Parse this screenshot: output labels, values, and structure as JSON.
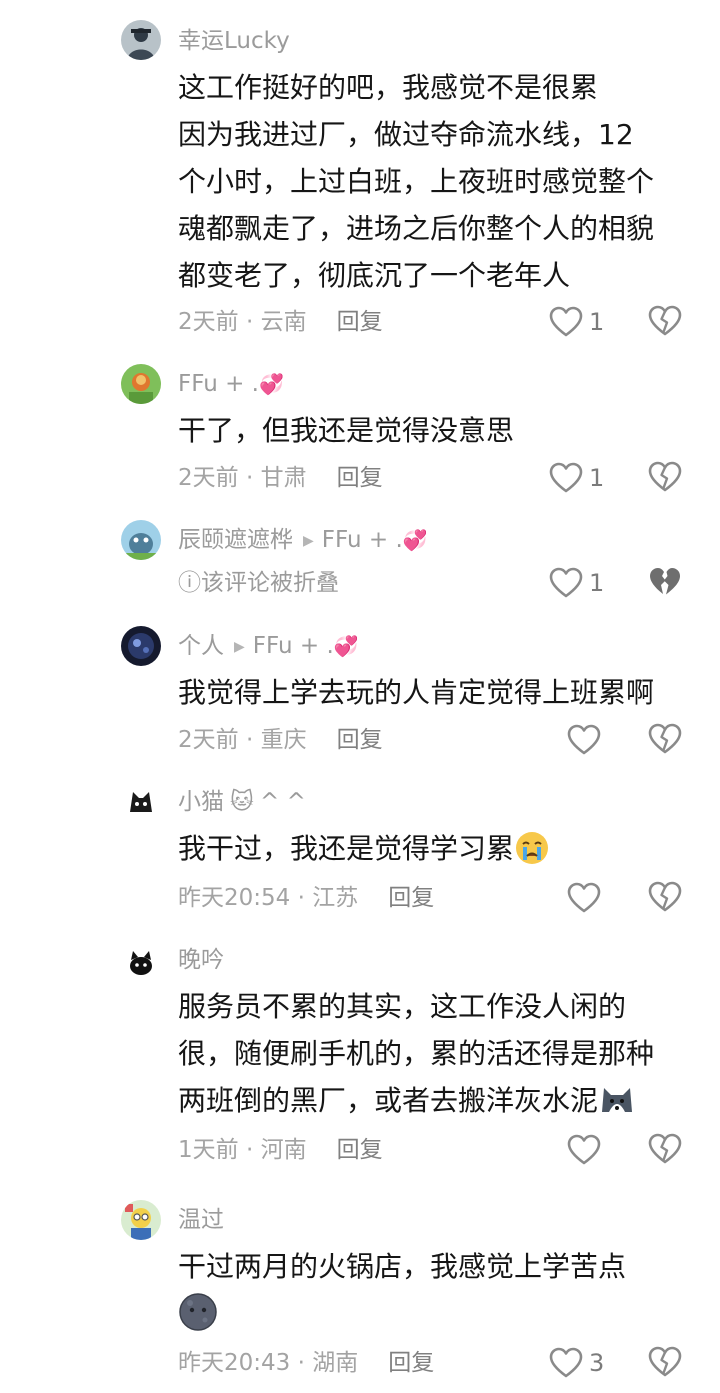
{
  "comments": [
    {
      "username": "幸运Lucky",
      "text_lines": [
        "这工作挺好的吧，我感觉不是很累",
        "因为我进过厂，做过夺命流水线，12",
        "个小时，上过白班，上夜班时感觉整个",
        "魂都飘走了，进场之后你整个人的相貌",
        "都变老了，彻底沉了一个老年人"
      ],
      "time": "2天前",
      "location": "云南",
      "reply_label": "回复",
      "like_count": "1"
    },
    {
      "username": "FFu + .",
      "text_lines": [
        "干了，但我还是觉得没意思"
      ],
      "time": "2天前",
      "location": "甘肃",
      "reply_label": "回复",
      "like_count": "1"
    },
    {
      "username": "辰颐遮遮桦",
      "reply_to": "FFu + .",
      "folded_text": "该评论被折叠",
      "like_count": "1"
    },
    {
      "username": "个人",
      "reply_to": "FFu + .",
      "text_lines": [
        "我觉得上学去玩的人肯定觉得上班累啊"
      ],
      "time": "2天前",
      "location": "重庆",
      "reply_label": "回复"
    },
    {
      "username": "小猫",
      "username_suffix": "^ ^",
      "text_lines": [
        "我干过，我还是觉得学习累"
      ],
      "time": "昨天20:54",
      "location": "江苏",
      "reply_label": "回复"
    },
    {
      "username": "晚吟",
      "text_lines": [
        "服务员不累的其实，这工作没人闲的",
        "很，随便刷手机的，累的活还得是那种",
        "两班倒的黑厂，或者去搬洋灰水泥"
      ],
      "time": "1天前",
      "location": "河南",
      "reply_label": "回复"
    },
    {
      "username": "温过",
      "text_lines": [
        "干过两月的火锅店，我感觉上学苦点"
      ],
      "time": "昨天20:43",
      "location": "湖南",
      "reply_label": "回复",
      "like_count": "3"
    }
  ],
  "separator": "·",
  "colors": {
    "text": "#161616",
    "meta": "#a3a3a3",
    "username": "#9b9b9b",
    "icon": "#8a8a8a"
  }
}
